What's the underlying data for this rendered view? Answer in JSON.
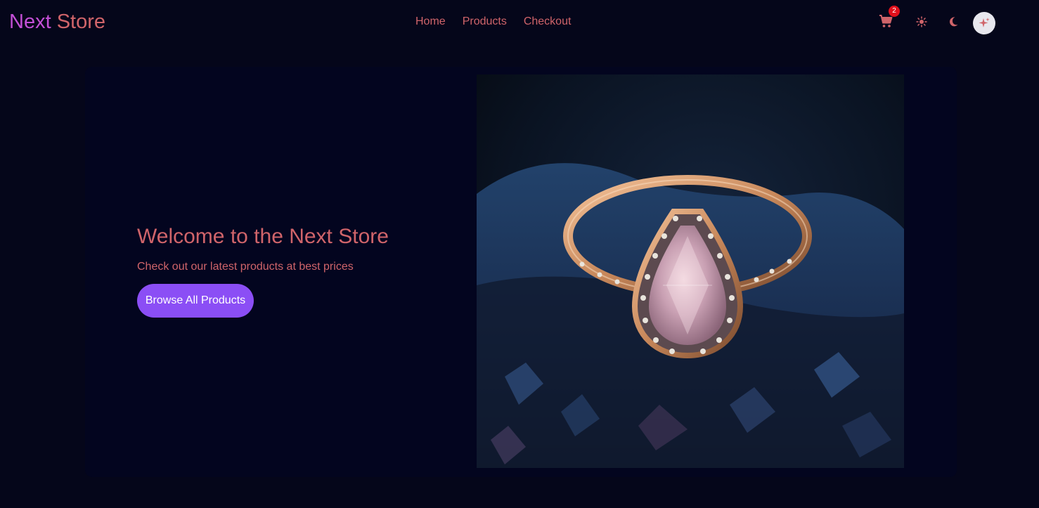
{
  "navbar": {
    "brand_word_1": "Next",
    "brand_word_2": "Store",
    "links": [
      "Home",
      "Products",
      "Checkout"
    ],
    "cart_count": "2",
    "icons": [
      "cart-icon",
      "sun-icon",
      "moon-icon",
      "sparkle-icon"
    ]
  },
  "hero": {
    "title": "Welcome to the Next Store",
    "subtitle": "Check out our latest products at best prices",
    "cta_label": "Browse All Products",
    "image_subject": "rose-gold-pear-ring-photo"
  },
  "colors": {
    "background": "#05061a",
    "card": "#03051f",
    "text_accent": "#d0646a",
    "brand_purple": "#c34fd6",
    "button": "#8b4ef5",
    "badge": "#e0101c"
  }
}
